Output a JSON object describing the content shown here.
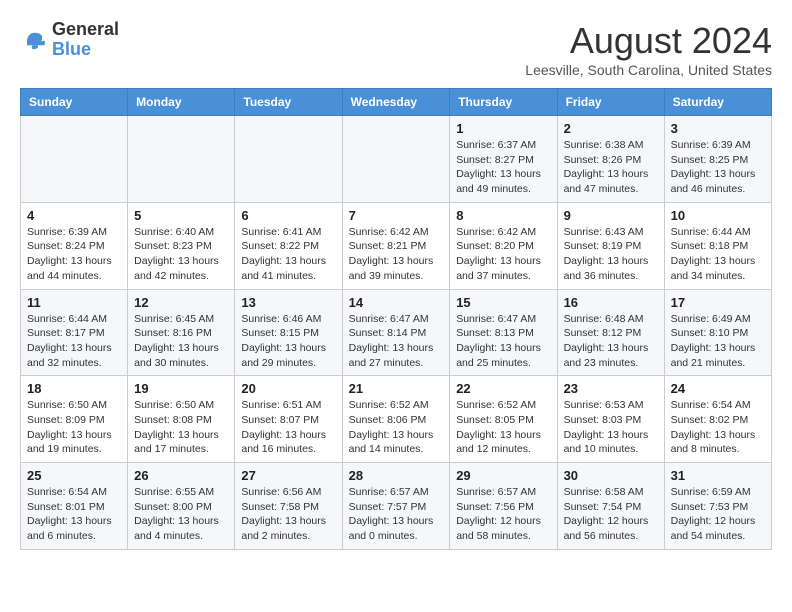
{
  "header": {
    "logo_line1": "General",
    "logo_line2": "Blue",
    "month_title": "August 2024",
    "location": "Leesville, South Carolina, United States"
  },
  "calendar": {
    "days_of_week": [
      "Sunday",
      "Monday",
      "Tuesday",
      "Wednesday",
      "Thursday",
      "Friday",
      "Saturday"
    ],
    "weeks": [
      [
        {
          "day": "",
          "info": ""
        },
        {
          "day": "",
          "info": ""
        },
        {
          "day": "",
          "info": ""
        },
        {
          "day": "",
          "info": ""
        },
        {
          "day": "1",
          "info": "Sunrise: 6:37 AM\nSunset: 8:27 PM\nDaylight: 13 hours\nand 49 minutes."
        },
        {
          "day": "2",
          "info": "Sunrise: 6:38 AM\nSunset: 8:26 PM\nDaylight: 13 hours\nand 47 minutes."
        },
        {
          "day": "3",
          "info": "Sunrise: 6:39 AM\nSunset: 8:25 PM\nDaylight: 13 hours\nand 46 minutes."
        }
      ],
      [
        {
          "day": "4",
          "info": "Sunrise: 6:39 AM\nSunset: 8:24 PM\nDaylight: 13 hours\nand 44 minutes."
        },
        {
          "day": "5",
          "info": "Sunrise: 6:40 AM\nSunset: 8:23 PM\nDaylight: 13 hours\nand 42 minutes."
        },
        {
          "day": "6",
          "info": "Sunrise: 6:41 AM\nSunset: 8:22 PM\nDaylight: 13 hours\nand 41 minutes."
        },
        {
          "day": "7",
          "info": "Sunrise: 6:42 AM\nSunset: 8:21 PM\nDaylight: 13 hours\nand 39 minutes."
        },
        {
          "day": "8",
          "info": "Sunrise: 6:42 AM\nSunset: 8:20 PM\nDaylight: 13 hours\nand 37 minutes."
        },
        {
          "day": "9",
          "info": "Sunrise: 6:43 AM\nSunset: 8:19 PM\nDaylight: 13 hours\nand 36 minutes."
        },
        {
          "day": "10",
          "info": "Sunrise: 6:44 AM\nSunset: 8:18 PM\nDaylight: 13 hours\nand 34 minutes."
        }
      ],
      [
        {
          "day": "11",
          "info": "Sunrise: 6:44 AM\nSunset: 8:17 PM\nDaylight: 13 hours\nand 32 minutes."
        },
        {
          "day": "12",
          "info": "Sunrise: 6:45 AM\nSunset: 8:16 PM\nDaylight: 13 hours\nand 30 minutes."
        },
        {
          "day": "13",
          "info": "Sunrise: 6:46 AM\nSunset: 8:15 PM\nDaylight: 13 hours\nand 29 minutes."
        },
        {
          "day": "14",
          "info": "Sunrise: 6:47 AM\nSunset: 8:14 PM\nDaylight: 13 hours\nand 27 minutes."
        },
        {
          "day": "15",
          "info": "Sunrise: 6:47 AM\nSunset: 8:13 PM\nDaylight: 13 hours\nand 25 minutes."
        },
        {
          "day": "16",
          "info": "Sunrise: 6:48 AM\nSunset: 8:12 PM\nDaylight: 13 hours\nand 23 minutes."
        },
        {
          "day": "17",
          "info": "Sunrise: 6:49 AM\nSunset: 8:10 PM\nDaylight: 13 hours\nand 21 minutes."
        }
      ],
      [
        {
          "day": "18",
          "info": "Sunrise: 6:50 AM\nSunset: 8:09 PM\nDaylight: 13 hours\nand 19 minutes."
        },
        {
          "day": "19",
          "info": "Sunrise: 6:50 AM\nSunset: 8:08 PM\nDaylight: 13 hours\nand 17 minutes."
        },
        {
          "day": "20",
          "info": "Sunrise: 6:51 AM\nSunset: 8:07 PM\nDaylight: 13 hours\nand 16 minutes."
        },
        {
          "day": "21",
          "info": "Sunrise: 6:52 AM\nSunset: 8:06 PM\nDaylight: 13 hours\nand 14 minutes."
        },
        {
          "day": "22",
          "info": "Sunrise: 6:52 AM\nSunset: 8:05 PM\nDaylight: 13 hours\nand 12 minutes."
        },
        {
          "day": "23",
          "info": "Sunrise: 6:53 AM\nSunset: 8:03 PM\nDaylight: 13 hours\nand 10 minutes."
        },
        {
          "day": "24",
          "info": "Sunrise: 6:54 AM\nSunset: 8:02 PM\nDaylight: 13 hours\nand 8 minutes."
        }
      ],
      [
        {
          "day": "25",
          "info": "Sunrise: 6:54 AM\nSunset: 8:01 PM\nDaylight: 13 hours\nand 6 minutes."
        },
        {
          "day": "26",
          "info": "Sunrise: 6:55 AM\nSunset: 8:00 PM\nDaylight: 13 hours\nand 4 minutes."
        },
        {
          "day": "27",
          "info": "Sunrise: 6:56 AM\nSunset: 7:58 PM\nDaylight: 13 hours\nand 2 minutes."
        },
        {
          "day": "28",
          "info": "Sunrise: 6:57 AM\nSunset: 7:57 PM\nDaylight: 13 hours\nand 0 minutes."
        },
        {
          "day": "29",
          "info": "Sunrise: 6:57 AM\nSunset: 7:56 PM\nDaylight: 12 hours\nand 58 minutes."
        },
        {
          "day": "30",
          "info": "Sunrise: 6:58 AM\nSunset: 7:54 PM\nDaylight: 12 hours\nand 56 minutes."
        },
        {
          "day": "31",
          "info": "Sunrise: 6:59 AM\nSunset: 7:53 PM\nDaylight: 12 hours\nand 54 minutes."
        }
      ]
    ]
  }
}
